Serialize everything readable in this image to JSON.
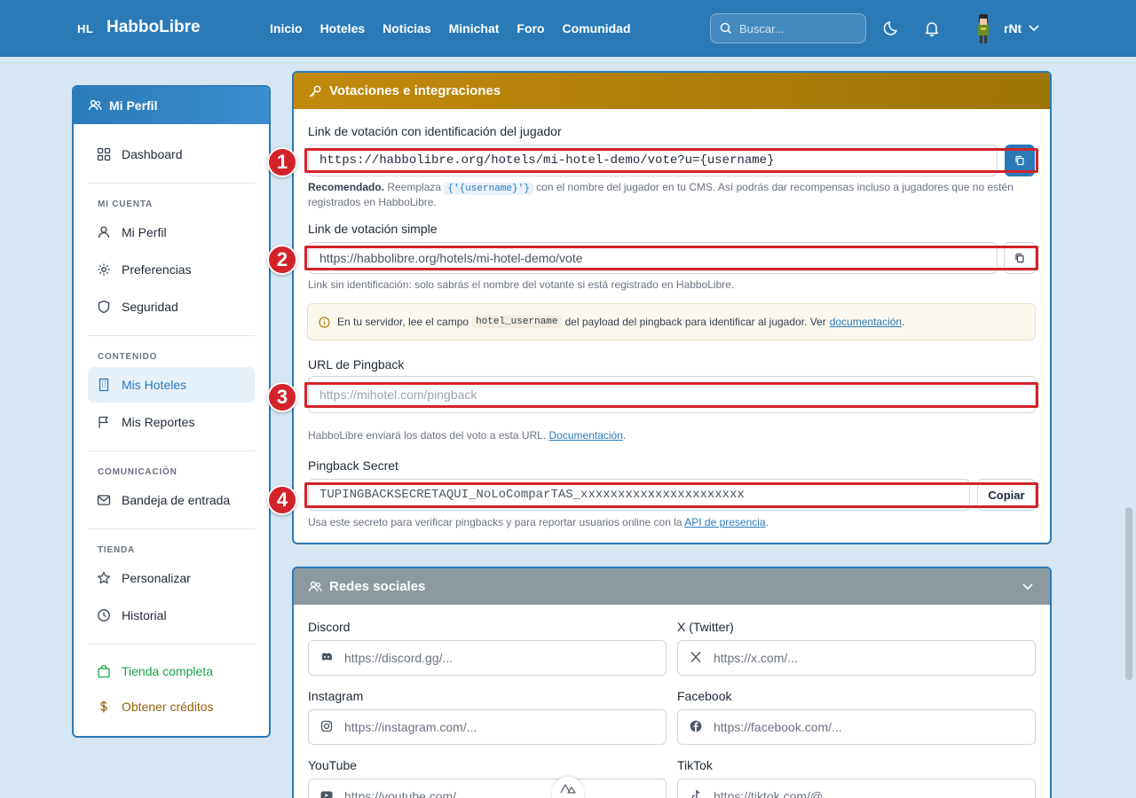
{
  "brand": {
    "short": "HL",
    "name": "HabboLibre"
  },
  "nav": [
    "Inicio",
    "Hoteles",
    "Noticias",
    "Minichat",
    "Foro",
    "Comunidad"
  ],
  "search": {
    "placeholder": "Buscar..."
  },
  "user": {
    "name": "rNt"
  },
  "sidebar": {
    "title": "Mi Perfil",
    "dashboard": "Dashboard",
    "sections": {
      "account": "MI CUENTA",
      "content": "CONTENIDO",
      "comms": "COMUNICACIÓN",
      "store": "TIENDA"
    },
    "items": {
      "profile": "Mi Perfil",
      "preferences": "Preferencias",
      "security": "Seguridad",
      "hotels": "Mis Hoteles",
      "reports": "Mis Reportes",
      "inbox": "Bandeja de entrada",
      "customize": "Personalizar",
      "history": "Historial",
      "full_store": "Tienda completa",
      "credits": "Obtener créditos"
    }
  },
  "voting": {
    "title": "Votaciones e integraciones",
    "link_id_label": "Link de votación con identificación del jugador",
    "link_id_value": "https://habbolibre.org/hotels/mi-hotel-demo/vote?u={username}",
    "link_id_help_strong": "Recomendado.",
    "link_id_help_pre": " Reemplaza ",
    "link_id_help_code": "{'{username}'}",
    "link_id_help_post": " con el nombre del jugador en tu CMS. Así podrás dar recompensas incluso a jugadores que no estén registrados en HabboLibre.",
    "link_simple_label": "Link de votación simple",
    "link_simple_value": "https://habbolibre.org/hotels/mi-hotel-demo/vote",
    "link_simple_help": "Link sin identificación: solo sabrás el nombre del votante si está registrado en HabboLibre.",
    "note_pre": "En tu servidor, lee el campo",
    "note_code": "hotel_username",
    "note_mid": "del payload del pingback para identificar al jugador. Ver",
    "note_link": "documentación",
    "note_end": ".",
    "pingback_label": "URL de Pingback",
    "pingback_placeholder": "https://mihotel.com/pingback",
    "pingback_help_pre": "HabboLibre enviará los datos del voto a esta URL.",
    "pingback_help_link": "Documentación",
    "pingback_help_end": ".",
    "secret_label": "Pingback Secret",
    "secret_value": "TUPINGBACKSECRETAQUI_NoLoComparTAS_xxxxxxxxxxxxxxxxxxxxxx",
    "copy_label": "Copiar",
    "secret_help_pre": "Usa este secreto para verificar pingbacks y para reportar usuarios online con la",
    "secret_help_link": "API de presencia",
    "secret_help_end": "."
  },
  "social": {
    "title": "Redes sociales",
    "discord_label": "Discord",
    "discord_ph": "https://discord.gg/...",
    "x_label": "X (Twitter)",
    "x_ph": "https://x.com/...",
    "instagram_label": "Instagram",
    "instagram_ph": "https://instagram.com/...",
    "facebook_label": "Facebook",
    "facebook_ph": "https://facebook.com/...",
    "youtube_label": "YouTube",
    "youtube_ph": "https://youtube.com/...",
    "tiktok_label": "TikTok",
    "tiktok_ph": "https://tiktok.com/@..."
  },
  "annotations": [
    "1",
    "2",
    "3",
    "4"
  ],
  "colors": {
    "primary": "#2a7ab8",
    "voting_header": "#b0810a",
    "social_header": "#8c9a9f",
    "annotation": "#d3232a"
  }
}
